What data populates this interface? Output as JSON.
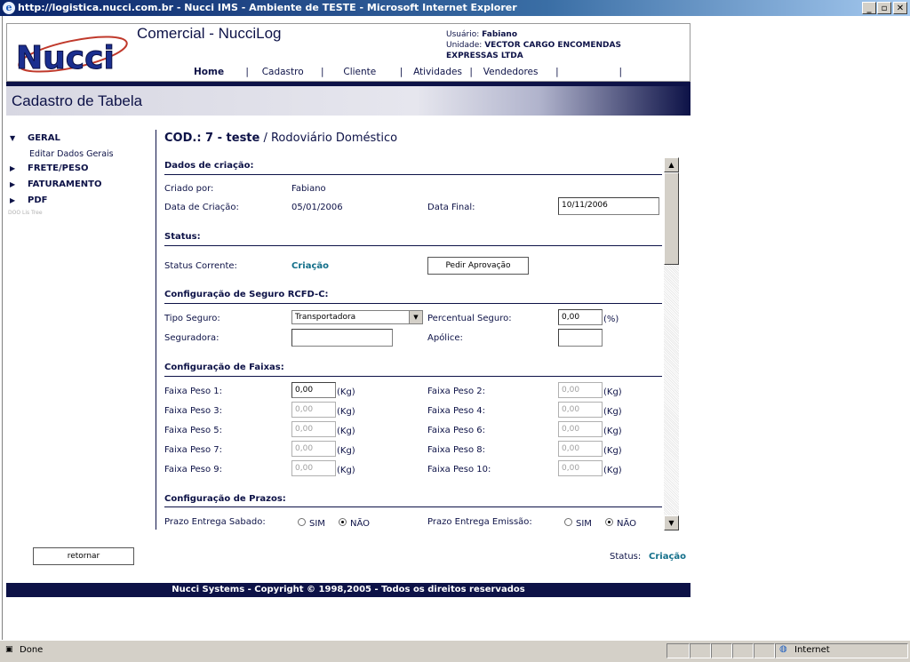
{
  "window": {
    "title": "http://logistica.nucci.com.br - Nucci IMS - Ambiente de TESTE - Microsoft Internet Explorer",
    "minimize": "_",
    "maximize": "▫",
    "close": "✕"
  },
  "header": {
    "app_title": "Comercial - NucciLog",
    "user_label": "Usuário:",
    "user_value": "Fabiano",
    "unit_label": "Unidade:",
    "unit_value_line1": "VECTOR CARGO ENCOMENDAS",
    "unit_value_line2": "EXPRESSAS LTDA",
    "logo_text": "Nucci",
    "nav": [
      "Home",
      "Cadastro",
      "Cliente",
      "Atividades",
      "Vendedores"
    ],
    "nav_sep": "|"
  },
  "page_title": "Cadastro de Tabela",
  "sidebar": {
    "items": [
      {
        "label": "GERAL",
        "arrow": "▼"
      },
      {
        "label": "FRETE/PESO",
        "arrow": "▶"
      },
      {
        "label": "FATURAMENTO",
        "arrow": "▶"
      },
      {
        "label": "PDF",
        "arrow": "▶"
      }
    ],
    "sub_item": "Editar Dados Gerais",
    "tiny_text": "DOO Lis Tree"
  },
  "content": {
    "cod_prefix": "COD.: 7 - teste",
    "cod_suffix": " / Rodoviário Doméstico",
    "dados": {
      "heading": "Dados de criação:",
      "criado_por_label": "Criado por:",
      "criado_por_value": "Fabiano",
      "data_criacao_label": "Data de Criação:",
      "data_criacao_value": "05/01/2006",
      "data_final_label": "Data Final:",
      "data_final_value": "10/11/2006"
    },
    "status": {
      "heading": "Status:",
      "corrente_label": "Status Corrente:",
      "corrente_value": "Criação",
      "pedir_button": "Pedir Aprovação"
    },
    "seguro": {
      "heading": "Configuração de Seguro RCFD-C:",
      "tipo_label": "Tipo Seguro:",
      "tipo_value": "Transportadora",
      "percentual_label": "Percentual Seguro:",
      "percentual_value": "0,00",
      "percentual_unit": "(%)",
      "seguradora_label": "Seguradora:",
      "seguradora_value": "",
      "apolice_label": "Apólice:",
      "apolice_value": ""
    },
    "faixas": {
      "heading": "Configuração de Faixas:",
      "unit": "(Kg)",
      "items": [
        {
          "label": "Faixa Peso 1:",
          "value": "0,00"
        },
        {
          "label": "Faixa Peso 2:",
          "value": "0,00"
        },
        {
          "label": "Faixa Peso 3:",
          "value": "0,00"
        },
        {
          "label": "Faixa Peso 4:",
          "value": "0,00"
        },
        {
          "label": "Faixa Peso 5:",
          "value": "0,00"
        },
        {
          "label": "Faixa Peso 6:",
          "value": "0,00"
        },
        {
          "label": "Faixa Peso 7:",
          "value": "0,00"
        },
        {
          "label": "Faixa Peso 8:",
          "value": "0,00"
        },
        {
          "label": "Faixa Peso 9:",
          "value": "0,00"
        },
        {
          "label": "Faixa Peso 10:",
          "value": "0,00"
        }
      ]
    },
    "prazos": {
      "heading": "Configuração de Prazos:",
      "sabado_label": "Prazo Entrega Sabado:",
      "emissao_label": "Prazo Entrega Emissão:",
      "sim": "SIM",
      "nao": "NÃO"
    }
  },
  "bottom": {
    "retornar_button": "retornar",
    "status_label": "Status:",
    "status_value": "Criação"
  },
  "footer": "Nucci Systems - Copyright © 1998,2005 - Todos os direitos reservados",
  "statusbar": {
    "done": "Done",
    "zone": "Internet"
  },
  "colors": {
    "brand_navy": "#0d1247",
    "status_teal": "#136f8a"
  }
}
